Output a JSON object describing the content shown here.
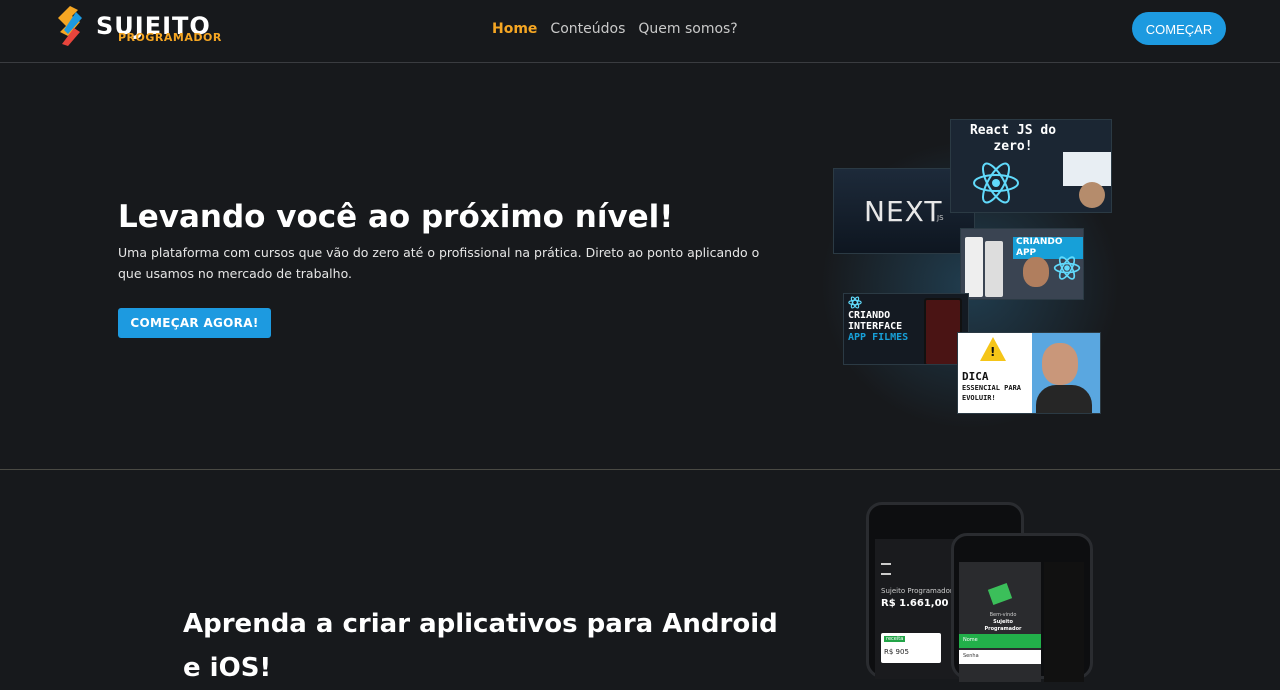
{
  "header": {
    "logo_title": "SUJEITO",
    "logo_subtitle": "PROGRAMADOR",
    "nav": [
      {
        "label": "Home",
        "active": true
      },
      {
        "label": "Conteúdos",
        "active": false
      },
      {
        "label": "Quem somos?",
        "active": false
      }
    ],
    "cta_label": "COMEÇAR"
  },
  "hero": {
    "title": "Levando você ao próximo nível!",
    "description": "Uma plataforma com cursos que vão do zero até o profissional na prática. Direto ao ponto aplicando o que usamos no mercado de trabalho.",
    "cta_label": "COMEÇAR AGORA!",
    "thumbnails": {
      "react": "React JS do zero!",
      "next": "NEXT",
      "next_sub": "JS",
      "app": "CRIANDO APP",
      "films_line1": "CRIANDO INTERFACE",
      "films_line2": "APP FILMES",
      "dica_title": "DICA",
      "dica_sub": "ESSENCIAL PARA EVOLUIR!"
    }
  },
  "section2": {
    "title": "Aprenda a criar aplicativos para Android e iOS!",
    "phone_a": {
      "label": "Sujeito Programador",
      "balance": "R$ 1.661,00",
      "tag": "receita",
      "card_value": "R$ 905"
    },
    "phone_b": {
      "welcome": "Bem-vindo",
      "brand": "Sujeito Programador",
      "field1": "Nome",
      "field2": "Senha"
    }
  },
  "colors": {
    "background": "#17191c",
    "accent_orange": "#f5a623",
    "accent_blue": "#1d9ae0"
  }
}
